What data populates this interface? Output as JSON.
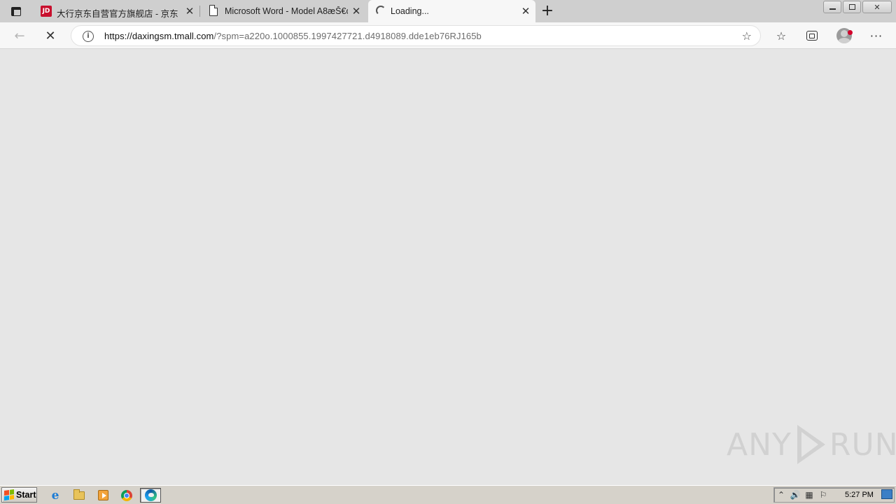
{
  "browser": {
    "tabs": [
      {
        "title": "大行京东自营官方旗舰店 - 京东",
        "favicon": "jd-logo",
        "favicon_text": "JD",
        "active": false
      },
      {
        "title": "Microsoft Word - Model A8æŠ€ç",
        "favicon": "document-icon",
        "active": false
      },
      {
        "title": "Loading...",
        "favicon": "loading-spinner",
        "active": true
      }
    ],
    "close_glyph": "✕",
    "new_tab_glyph": "+",
    "address": {
      "host": "https://daxingsm.tmall.com",
      "path": "/?spm=a220o.1000855.1997427721.d4918089.dde1eb76RJ165b"
    },
    "toolbar_glyphs": {
      "back": "←",
      "stop": "✕",
      "info": "i",
      "add_favorite": "☆",
      "favorites": "☆",
      "menu": "···"
    }
  },
  "watermark": {
    "left": "ANY",
    "right": "RUN"
  },
  "taskbar": {
    "start_label": "Start",
    "apps": [
      "internet-explorer",
      "file-explorer",
      "media-player",
      "chrome",
      "edge"
    ],
    "ie_glyph": "e",
    "tray_glyphs": {
      "expand": "⌃",
      "volume": "🔊",
      "network": "▦",
      "flag": "⚐"
    },
    "clock": "5:27 PM"
  },
  "colors": {
    "tabstrip": "#cfcfcf",
    "content_bg": "#e6e6e6",
    "jd_red": "#c8102e",
    "profile_badge": "#d3002b",
    "taskbar": "#d6d2ca"
  }
}
